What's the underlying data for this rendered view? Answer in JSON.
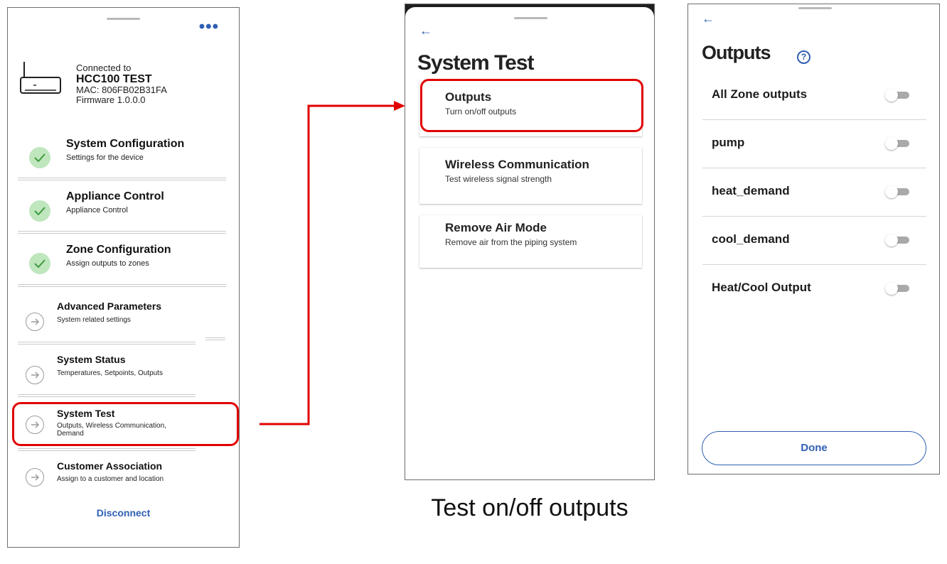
{
  "screen1": {
    "more_icon": "more-horizontal-icon",
    "connection": {
      "connected_to": "Connected to",
      "device_name": "HCC100 TEST",
      "mac": "MAC: 806FB02B31FA",
      "firmware": "Firmware 1.0.0.0"
    },
    "items": [
      {
        "title": "System Configuration",
        "subtitle": "Settings for the device",
        "status": "complete"
      },
      {
        "title": "Appliance Control",
        "subtitle": "Appliance Control",
        "status": "complete"
      },
      {
        "title": "Zone Configuration",
        "subtitle": "Assign outputs to zones",
        "status": "complete"
      },
      {
        "title": "Advanced Parameters",
        "subtitle": "System related settings",
        "status": "navigate"
      },
      {
        "title": "System Status",
        "subtitle": "Temperatures, Setpoints, Outputs",
        "status": "navigate"
      },
      {
        "title": "System Test",
        "subtitle": "Outputs, Wireless Communication, Demand",
        "status": "navigate"
      },
      {
        "title": "Customer Association",
        "subtitle": "Assign to a customer and location",
        "status": "navigate"
      }
    ],
    "disconnect_label": "Disconnect"
  },
  "screen2": {
    "title": "System Test",
    "cards": [
      {
        "title": "Outputs",
        "subtitle": "Turn on/off outputs"
      },
      {
        "title": "Wireless Communication",
        "subtitle": "Test wireless signal strength"
      },
      {
        "title": "Remove Air Mode",
        "subtitle": "Remove air from the piping system"
      }
    ]
  },
  "screen3": {
    "title": "Outputs",
    "help_label": "?",
    "outputs": [
      {
        "label": "All Zone outputs",
        "on": false
      },
      {
        "label": "pump",
        "on": false
      },
      {
        "label": "heat_demand",
        "on": false
      },
      {
        "label": "cool_demand",
        "on": false
      },
      {
        "label": "Heat/Cool Output",
        "on": false
      }
    ],
    "done_label": "Done"
  },
  "caption": "Test on/off outputs",
  "colors": {
    "accent": "#2f5fb3",
    "highlight": "#e00000",
    "check_bg": "#bfe6bd",
    "check_mark": "#3f9a3f"
  }
}
